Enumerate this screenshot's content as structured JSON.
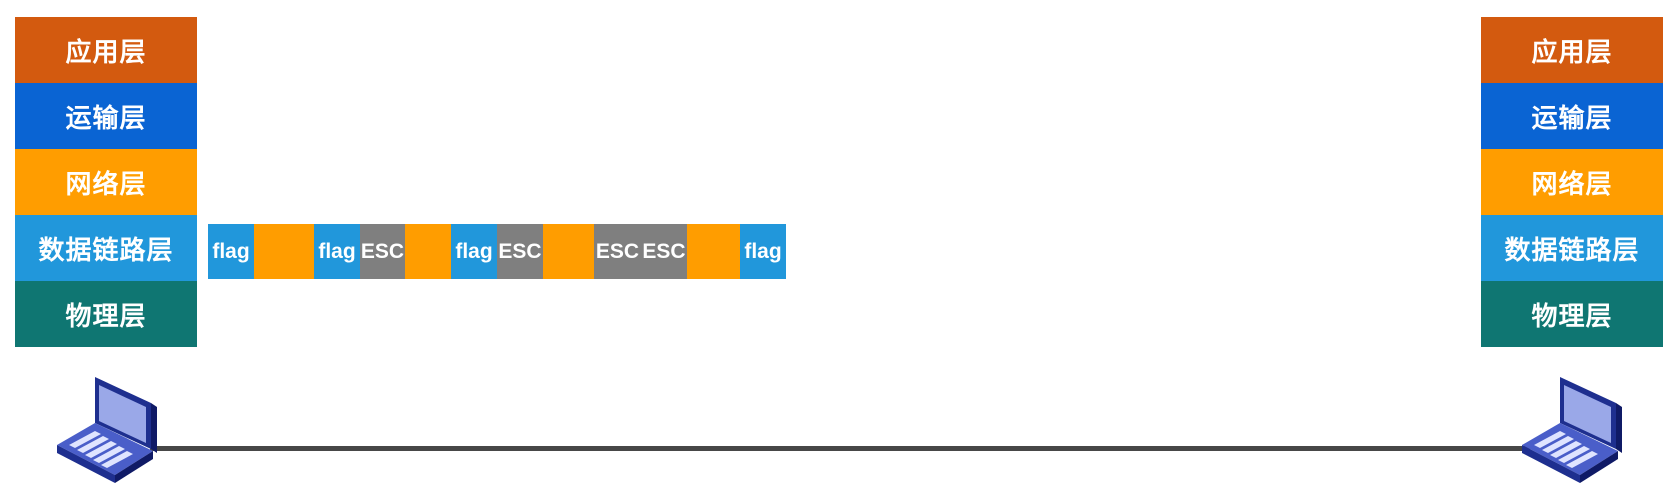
{
  "left_stack": {
    "layers": [
      {
        "label": "应用层",
        "color": "#d35a0f"
      },
      {
        "label": "运输层",
        "color": "#0a64d3"
      },
      {
        "label": "网络层",
        "color": "#ff9d00"
      },
      {
        "label": "数据链路层",
        "color": "#2197db"
      },
      {
        "label": "物理层",
        "color": "#0f7672"
      }
    ]
  },
  "right_stack": {
    "layers": [
      {
        "label": "应用层",
        "color": "#d35a0f"
      },
      {
        "label": "运输层",
        "color": "#0a64d3"
      },
      {
        "label": "网络层",
        "color": "#ff9d00"
      },
      {
        "label": "数据链路层",
        "color": "#2197db"
      },
      {
        "label": "物理层",
        "color": "#0f7672"
      }
    ]
  },
  "frame": {
    "segments": [
      {
        "kind": "flag",
        "label": "flag",
        "color": "#2197db"
      },
      {
        "kind": "data",
        "label": "",
        "color": "#ff9d00"
      },
      {
        "kind": "flag",
        "label": "flag",
        "color": "#2197db"
      },
      {
        "kind": "esc",
        "label": "ESC",
        "color": "#7f7f7f"
      },
      {
        "kind": "data",
        "label": "",
        "color": "#ff9d00"
      },
      {
        "kind": "flag",
        "label": "flag",
        "color": "#2197db"
      },
      {
        "kind": "esc",
        "label": "ESC",
        "color": "#7f7f7f"
      },
      {
        "kind": "data",
        "label": "",
        "color": "#ff9d00"
      },
      {
        "kind": "esc",
        "label": "ESC",
        "color": "#7f7f7f"
      },
      {
        "kind": "esc",
        "label": "ESC",
        "color": "#7f7f7f"
      },
      {
        "kind": "data",
        "label": "",
        "color": "#ff9d00"
      },
      {
        "kind": "flag",
        "label": "flag",
        "color": "#2197db"
      }
    ]
  },
  "icons": {
    "left_host": "laptop-icon",
    "right_host": "laptop-icon"
  },
  "cable_color": "#474747"
}
